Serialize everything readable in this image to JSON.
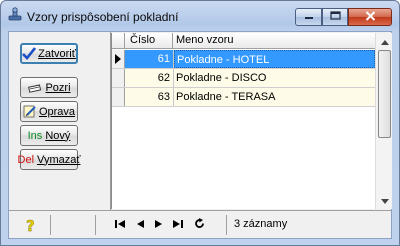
{
  "window": {
    "title": "Vzory prispôsobení pokladní",
    "app_icon": "stamp-icon",
    "controls": [
      "minimize-icon",
      "maximize-icon",
      "close-icon"
    ]
  },
  "buttons": {
    "zatvorit": {
      "label": "Zatvoriť",
      "icon": "checkmark-icon"
    },
    "pozri": {
      "label": "Pozri",
      "icon": "glasses-icon"
    },
    "oprava": {
      "label": "Oprava",
      "icon": "edit-icon"
    },
    "novy": {
      "prefix": "Ins",
      "label": "Nový"
    },
    "vymazat": {
      "prefix": "Del",
      "label": "Vymazať"
    }
  },
  "grid": {
    "columns": [
      "Číslo",
      "Meno vzoru"
    ],
    "rows": [
      {
        "cislo": "61",
        "meno": "Pokladne - HOTEL",
        "selected": true
      },
      {
        "cislo": "62",
        "meno": "Pokladne - DISCO",
        "selected": false
      },
      {
        "cislo": "63",
        "meno": "Pokladne - TERASA",
        "selected": false
      }
    ]
  },
  "status": {
    "help_icon": "help-icon",
    "nav": [
      "first-record-icon",
      "previous-record-icon",
      "next-record-icon",
      "last-record-icon",
      "refresh-icon"
    ],
    "record_count": "3 záznamy"
  },
  "colors": {
    "selection": "#3399ff",
    "row_background": "#fefce8",
    "ins_prefix": "#0a8a24",
    "del_prefix": "#d01010",
    "close_button": "#c0391b"
  }
}
